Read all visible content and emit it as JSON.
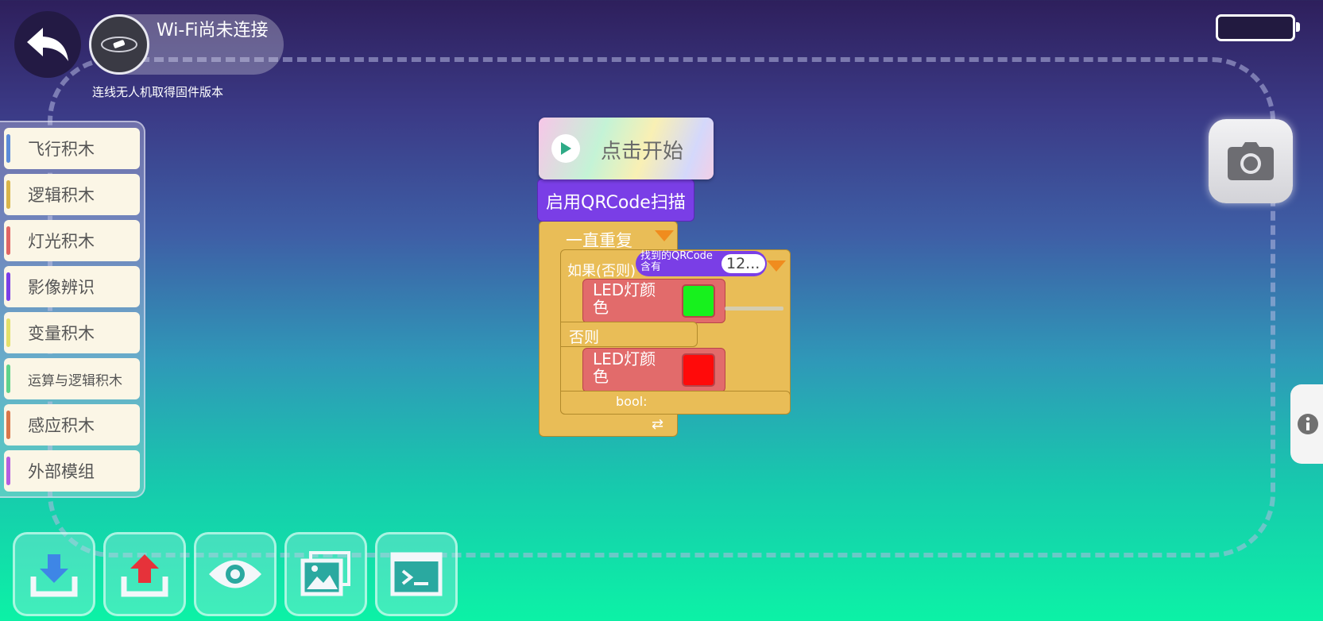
{
  "header": {
    "wifi_status": "Wi-Fi尚未连接",
    "firmware_hint": "连线无人机取得固件版本"
  },
  "sidebar": {
    "items": [
      {
        "label": "飞行积木",
        "color": "#5b8bd9"
      },
      {
        "label": "逻辑积木",
        "color": "#d9b54a"
      },
      {
        "label": "灯光积木",
        "color": "#e06464"
      },
      {
        "label": "影像辨识",
        "color": "#7a3ee6"
      },
      {
        "label": "变量积木",
        "color": "#e3e16a"
      },
      {
        "label": "运算与逻辑积木",
        "color": "#5ed38b"
      },
      {
        "label": "感应积木",
        "color": "#d9764a"
      },
      {
        "label": "外部模组",
        "color": "#b45ee0"
      }
    ]
  },
  "blocks": {
    "start_label": "点击开始",
    "qr_enable": "启用QRCode扫描",
    "repeat_label": "一直重复",
    "if_else_label": "如果(否则)",
    "qr_condition_line1": "找到的QRCode",
    "qr_condition_line2": "含有",
    "qr_value": "12...",
    "led_label_1": "LED灯颜",
    "led_label_2": "色",
    "led1_color": "#17f11d",
    "else_label": "否则",
    "led2_color": "#ff0a0a",
    "bool_label": "bool:"
  },
  "toolbar": {
    "icons": [
      "download-icon",
      "upload-icon",
      "eye-icon",
      "image-icon",
      "terminal-icon"
    ]
  },
  "colors": {
    "logic_block": "#e9bd57",
    "vision_block": "#7a3ee6",
    "light_block": "#e26b6b"
  }
}
